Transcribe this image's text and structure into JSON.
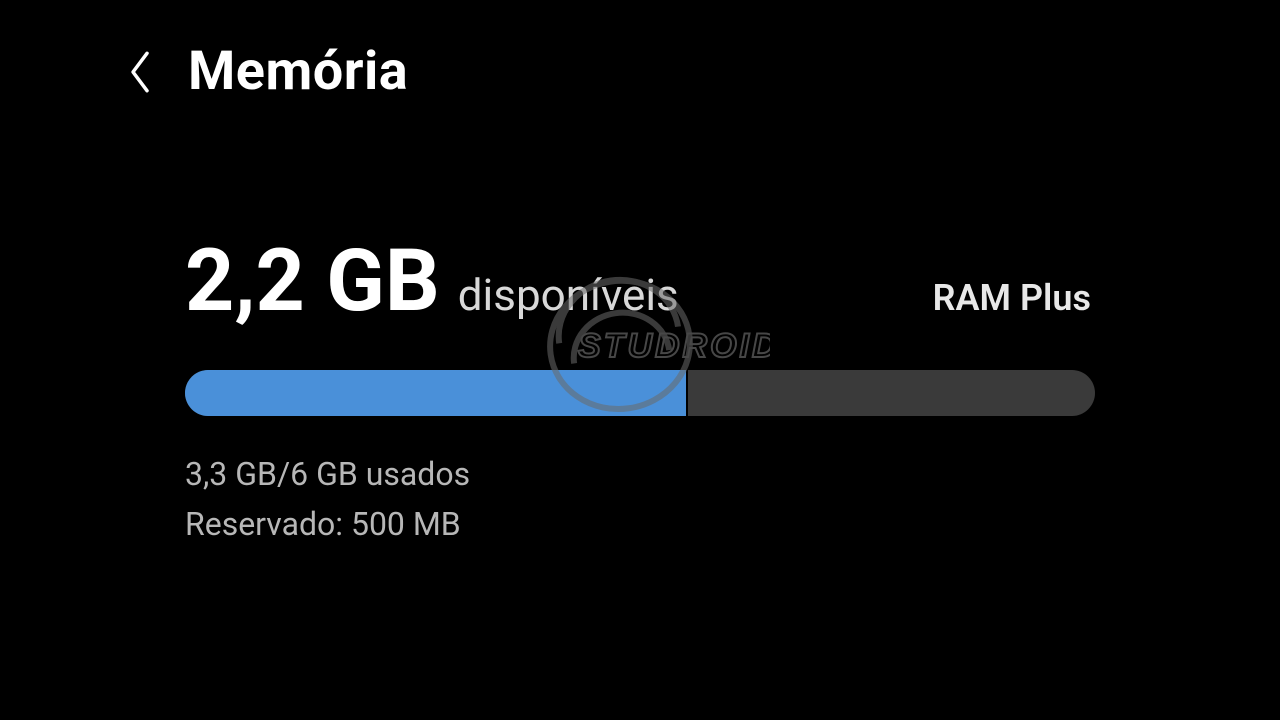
{
  "header": {
    "title": "Memória"
  },
  "memory": {
    "available_value": "2,2 GB",
    "available_label": "disponíveis",
    "ram_plus_label": "RAM Plus",
    "used_line": "3,3 GB/6 GB usados",
    "reserved_line": "Reservado: 500 MB",
    "progress_percent": 55,
    "bar_fill_color": "#4a90d9",
    "bar_track_color": "#3a3a3a"
  },
  "watermark": {
    "text": "STUDROID"
  }
}
